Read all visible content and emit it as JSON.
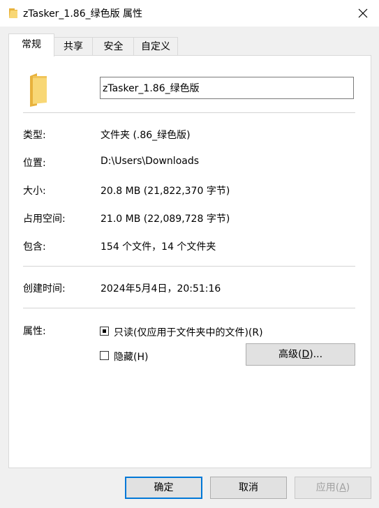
{
  "window": {
    "title": "zTasker_1.86_绿色版 属性",
    "title_icon": "folder-icon",
    "close_icon": "close-icon"
  },
  "tabs": [
    {
      "label": "常规",
      "active": true
    },
    {
      "label": "共享",
      "active": false
    },
    {
      "label": "安全",
      "active": false
    },
    {
      "label": "自定义",
      "active": false
    }
  ],
  "general": {
    "folder_name": "zTasker_1.86_绿色版",
    "rows": [
      {
        "label": "类型:",
        "value": "文件夹 (.86_绿色版)"
      },
      {
        "label": "位置:",
        "value": "D:\\Users\\Downloads"
      },
      {
        "label": "大小:",
        "value": "20.8 MB (21,822,370 字节)"
      },
      {
        "label": "占用空间:",
        "value": "21.0 MB (22,089,728 字节)"
      },
      {
        "label": "包含:",
        "value": "154 个文件，14 个文件夹"
      }
    ],
    "created_label": "创建时间:",
    "created_value": "2024年5月4日，20:51:16",
    "attributes_label": "属性:",
    "readonly_label": "只读(仅应用于文件夹中的文件)(R)",
    "readonly_state": "indeterminate",
    "hidden_label": "隐藏(H)",
    "hidden_checked": false,
    "advanced_button": {
      "text": "高级(",
      "key": "D",
      "suffix": ")..."
    }
  },
  "footer": {
    "ok_label": "确定",
    "cancel_label": "取消",
    "apply": {
      "text": "应用(",
      "key": "A",
      "suffix": ")",
      "disabled": true
    }
  },
  "colors": {
    "accent": "#0078d7",
    "folder_yellow": "#f8d775",
    "folder_dark": "#e8b23c"
  }
}
